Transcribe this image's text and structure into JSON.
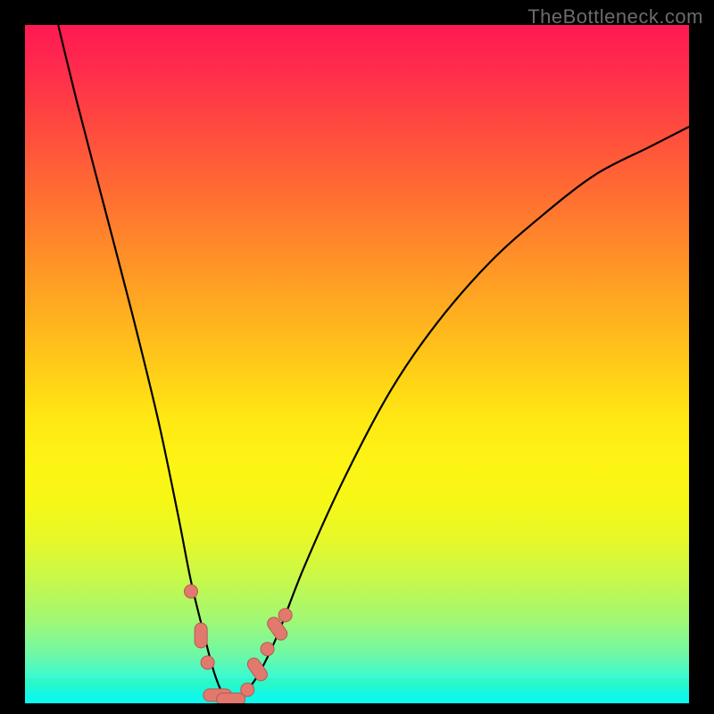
{
  "watermark": "TheBottleneck.com",
  "colors": {
    "frame": "#000000",
    "curve_stroke": "#000000",
    "marker_fill": "#e2796f",
    "marker_stroke": "#b8584f"
  },
  "chart_data": {
    "type": "line",
    "title": "",
    "xlabel": "",
    "ylabel": "",
    "xlim": [
      0,
      100
    ],
    "ylim": [
      0,
      100
    ],
    "grid": false,
    "legend": false,
    "background_gradient": "red-yellow-green vertical",
    "series": [
      {
        "name": "bottleneck-curve",
        "x": [
          5,
          8,
          12,
          16,
          20,
          23,
          25,
          27,
          28.5,
          30,
          31,
          32.5,
          35,
          38,
          42,
          48,
          55,
          62,
          70,
          78,
          86,
          94,
          100
        ],
        "y": [
          100,
          88,
          73,
          58,
          42,
          28,
          18,
          10,
          4.5,
          1,
          0.5,
          1,
          4,
          10,
          20,
          33,
          46,
          56,
          65,
          72,
          78,
          82,
          85
        ]
      }
    ],
    "markers": [
      {
        "x": 25.0,
        "y": 16.5,
        "shape": "circle"
      },
      {
        "x": 26.5,
        "y": 10.0,
        "shape": "pill-vertical"
      },
      {
        "x": 27.5,
        "y": 6.0,
        "shape": "circle"
      },
      {
        "x": 29.0,
        "y": 1.2,
        "shape": "pill-horizontal"
      },
      {
        "x": 31.0,
        "y": 0.6,
        "shape": "pill-horizontal"
      },
      {
        "x": 33.5,
        "y": 2.0,
        "shape": "circle"
      },
      {
        "x": 35.0,
        "y": 5.0,
        "shape": "pill-diagonal"
      },
      {
        "x": 36.5,
        "y": 8.0,
        "shape": "circle"
      },
      {
        "x": 38.0,
        "y": 11.0,
        "shape": "pill-diagonal"
      },
      {
        "x": 39.2,
        "y": 13.0,
        "shape": "circle"
      }
    ]
  }
}
